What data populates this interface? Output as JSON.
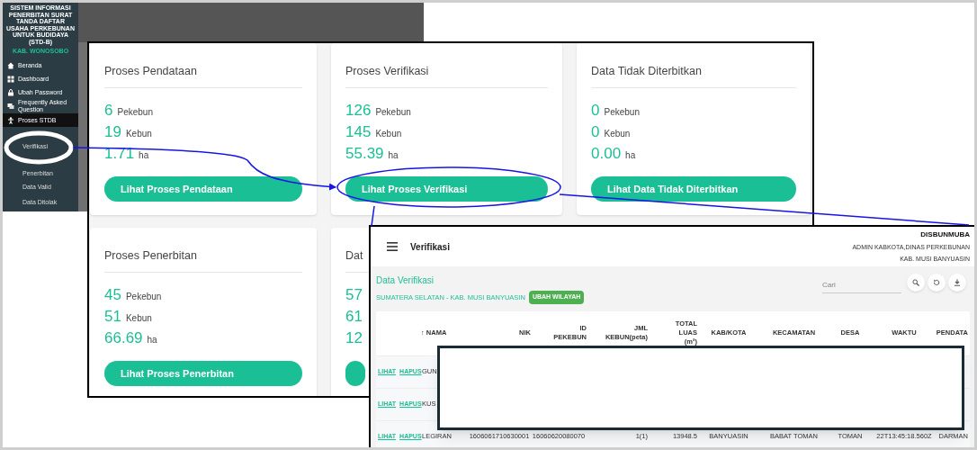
{
  "sidebar": {
    "app_title": "SISTEM INFORMASI PENERBITAN SURAT TANDA DAFTAR USAHA PERKEBUNAN UNTUK BUDIDAYA (STD-B)",
    "region": "KAB. WONOSOBO",
    "items": [
      {
        "label": "Beranda",
        "selected": false
      },
      {
        "label": "Dashboard",
        "selected": false
      },
      {
        "label": "Ubah Password",
        "selected": false
      },
      {
        "label": "Frequently Asked Question",
        "selected": false
      },
      {
        "label": "Proses STDB",
        "selected": true
      }
    ],
    "subitems": [
      {
        "label": "Verifikasi"
      },
      {
        "label": "Penerbitan"
      },
      {
        "label": "Data Valid"
      },
      {
        "label": "Data Ditolak"
      }
    ]
  },
  "dashboard": {
    "cards": [
      {
        "title": "Proses Pendataan",
        "stats": [
          {
            "value": "6",
            "unit": "Pekebun"
          },
          {
            "value": "19",
            "unit": "Kebun"
          },
          {
            "value": "1.71",
            "unit": "ha"
          }
        ],
        "button": "Lihat Proses Pendataan"
      },
      {
        "title": "Proses Verifikasi",
        "stats": [
          {
            "value": "126",
            "unit": "Pekebun"
          },
          {
            "value": "145",
            "unit": "Kebun"
          },
          {
            "value": "55.39",
            "unit": "ha"
          }
        ],
        "button": "Lihat Proses Verifikasi"
      },
      {
        "title": "Data Tidak Diterbitkan",
        "stats": [
          {
            "value": "0",
            "unit": "Pekebun"
          },
          {
            "value": "0",
            "unit": "Kebun"
          },
          {
            "value": "0.00",
            "unit": "ha"
          }
        ],
        "button": "Lihat Data Tidak Diterbitkan"
      },
      {
        "title": "Proses Penerbitan",
        "stats": [
          {
            "value": "45",
            "unit": "Pekebun"
          },
          {
            "value": "51",
            "unit": "Kebun"
          },
          {
            "value": "66.69",
            "unit": "ha"
          }
        ],
        "button": "Lihat Proses Penerbitan"
      },
      {
        "title": "Dat",
        "stats": [
          {
            "value": "57"
          },
          {
            "value": "61"
          },
          {
            "value": "12"
          }
        ]
      }
    ]
  },
  "verification": {
    "title": "Verifikasi",
    "user": "DISBUNMUBA",
    "role": "ADMIN KABKOTA,DINAS PERKEBUNAN",
    "office": "KAB. MUSI BANYUASIN",
    "heading": "Data Verifikasi",
    "region": "SUMATERA SELATAN - KAB. MUSI BANYUASIN",
    "region_button": "UBAH WILAYAH",
    "search": {
      "placeholder": "Cari"
    },
    "columns": [
      "↑ NAMA",
      "NIK",
      "ID\nPEKEBUN",
      "JML\nKEBUN(peta)",
      "TOTAL\nLUAS\n(m²)",
      "KAB/KOTA",
      "KECAMATAN",
      "DESA",
      "WAKTU",
      "PENDATA"
    ],
    "rows": [
      {
        "actions": [
          "LIHAT",
          "HAPUS"
        ],
        "cells": [
          "GUN"
        ]
      },
      {
        "actions": [
          "LIHAT",
          "HAPUS"
        ],
        "cells": [
          "KUS"
        ]
      },
      {
        "actions": [
          "LIHAT",
          "HAPUS"
        ],
        "cells": [
          "LEGIRAN",
          "1606061710630001",
          "16060620080070",
          "1(1)",
          "13948.5",
          "BANYUASIN",
          "BABAT TOMAN",
          "TOMAN",
          "22T13:45:18.560Z",
          "DARMAN"
        ]
      }
    ]
  }
}
